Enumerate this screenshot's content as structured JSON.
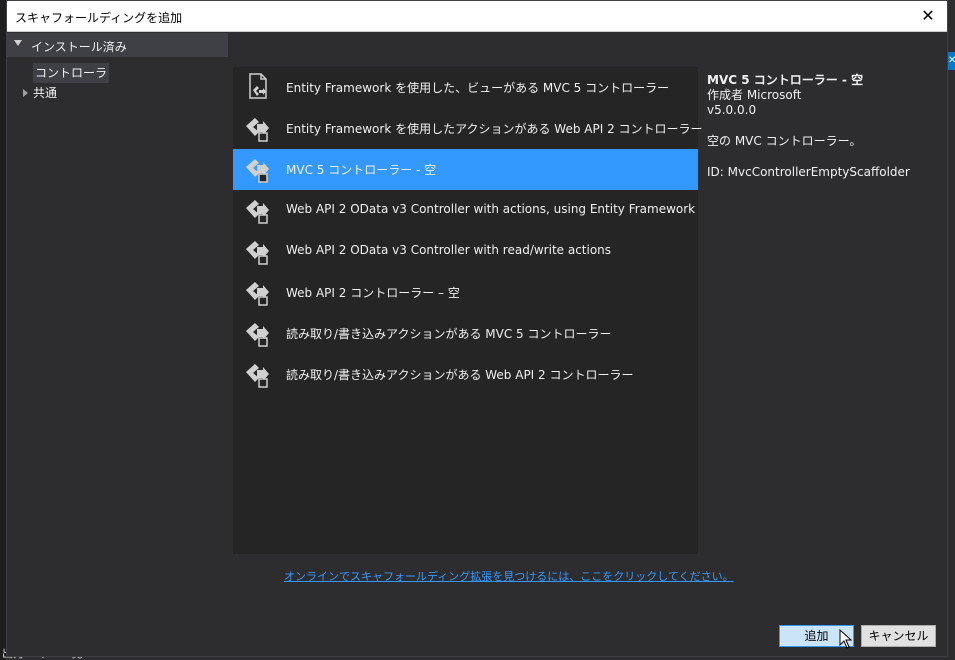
{
  "dialog": {
    "title": "スキャフォールディングを追加",
    "close_glyph": "✕"
  },
  "sidebar": {
    "header": "インストール済み",
    "items": [
      {
        "label": "コントローラ",
        "selected": true,
        "expandable": false
      },
      {
        "label": "共通",
        "selected": false,
        "expandable": true
      }
    ]
  },
  "scaffolds": [
    {
      "label": "Entity Framework を使用した、ビューがある MVC 5 コントローラー",
      "icon": "controller-with-views-icon",
      "selected": false
    },
    {
      "label": "Entity Framework を使用したアクションがある Web API 2 コントローラー",
      "icon": "controller-icon",
      "selected": false
    },
    {
      "label": "MVC 5 コントローラー - 空",
      "icon": "controller-icon",
      "selected": true
    },
    {
      "label": "Web API 2 OData v3 Controller with actions, using Entity Framework",
      "icon": "controller-icon",
      "selected": false
    },
    {
      "label": "Web API 2 OData v3 Controller with read/write actions",
      "icon": "controller-icon",
      "selected": false
    },
    {
      "label": "Web API 2 コントローラー – 空",
      "icon": "controller-icon",
      "selected": false
    },
    {
      "label": "読み取り/書き込みアクションがある MVC 5 コントローラー",
      "icon": "controller-icon",
      "selected": false
    },
    {
      "label": "読み取り/書き込みアクションがある Web API 2 コントローラー",
      "icon": "controller-icon",
      "selected": false
    }
  ],
  "details": {
    "name": "MVC 5 コントローラー - 空",
    "author": "作成者 Microsoft",
    "version": "v5.0.0.0",
    "description": "空の MVC コントローラー。",
    "id": "ID: MvcControllerEmptyScaffolder"
  },
  "online_link": "オンラインでスキャフォールディング拡張を見つけるには、ここをクリックしてください。",
  "buttons": {
    "add": "追加",
    "cancel": "キャンセル"
  },
  "background": {
    "bottom_text": "出力 エラー一覧"
  },
  "colors": {
    "accent": "#3399ff",
    "dialog_bg": "#2d2d30",
    "list_bg": "#252526"
  }
}
